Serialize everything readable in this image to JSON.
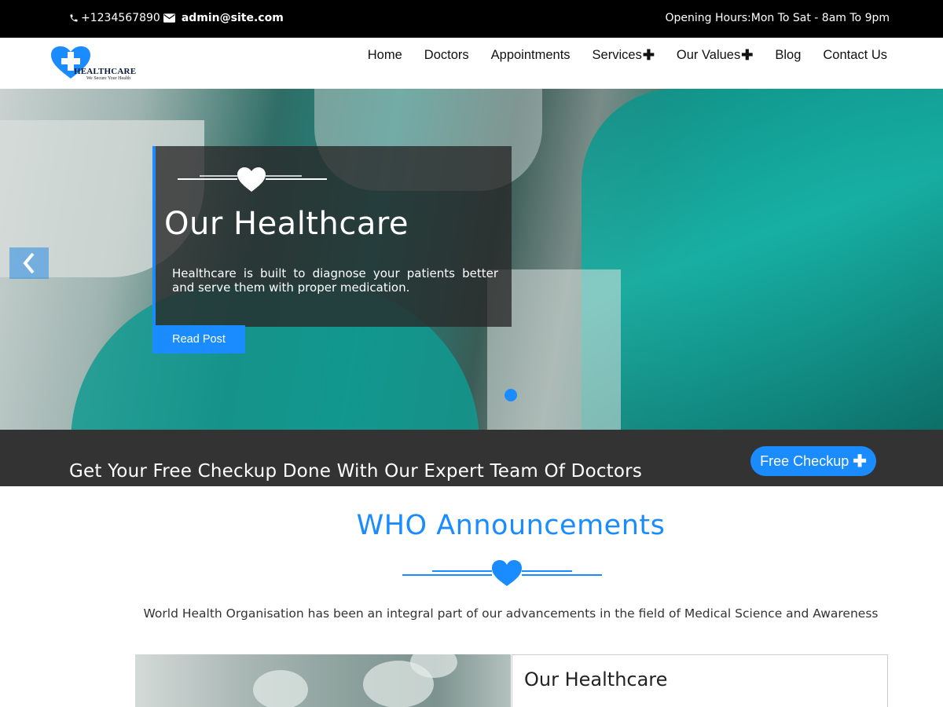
{
  "topbar": {
    "phone": "+1234567890",
    "email": "admin@site.com",
    "hours": "Opening Hours:Mon To Sat - 8am To 9pm"
  },
  "logo": {
    "title": "HEALTHCARE",
    "tagline": "We Secure Your Health"
  },
  "nav": {
    "home": "Home",
    "doctors": "Doctors",
    "appointments": "Appointments",
    "services": "Services",
    "values": "Our Values",
    "blog": "Blog",
    "contact": "Contact Us"
  },
  "hero": {
    "title": "Our Healthcare",
    "text": "Healthcare is built to diagnose your patients better and serve them with proper medication.",
    "button": "Read Post"
  },
  "cta": {
    "text": "Get Your Free Checkup Done With Our Expert Team Of Doctors",
    "button": "Free Checkup"
  },
  "announcements": {
    "title": "WHO Announcements",
    "description": "World Health Organisation has been an integral part of our advancements in the field of Medical Science and Awareness",
    "post_title": "Our Healthcare"
  },
  "colors": {
    "accent": "#1a8cff",
    "topbar": "#000000",
    "cta_band": "#333333"
  },
  "icons": {
    "phone": "phone-icon",
    "email": "envelope-icon",
    "prev": "chevron-left-icon",
    "heart": "heart-icon"
  }
}
